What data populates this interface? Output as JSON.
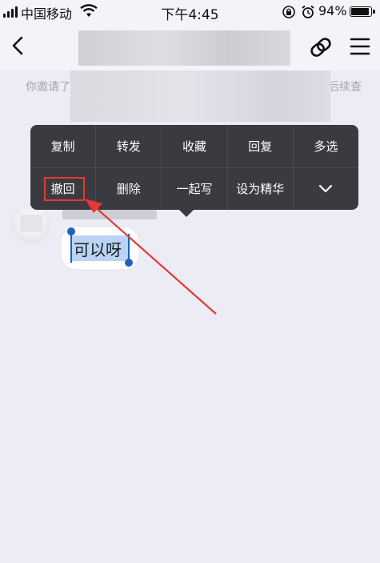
{
  "status_bar": {
    "carrier": "中国移动",
    "time": "下午4:45",
    "battery_percent": "94%",
    "battery_level": 0.94
  },
  "nav": {
    "back_icon": "chevron-left-icon",
    "share_icon": "share-link-icon",
    "menu_icon": "hamburger-menu-icon"
  },
  "notice": {
    "left_text": "你邀请了",
    "right_text": "后续查"
  },
  "context_menu": {
    "row1": [
      "复制",
      "转发",
      "收藏",
      "回复",
      "多选"
    ],
    "row2": [
      "撤回",
      "删除",
      "一起写",
      "设为精华"
    ],
    "more_icon": "chevron-down-icon"
  },
  "message": {
    "text": "可以呀"
  },
  "colors": {
    "background": "#ececf4",
    "menu": "#3a3b40",
    "highlight": "#e53935",
    "selection": "#b9d4f5",
    "caret": "#1e62c0"
  }
}
